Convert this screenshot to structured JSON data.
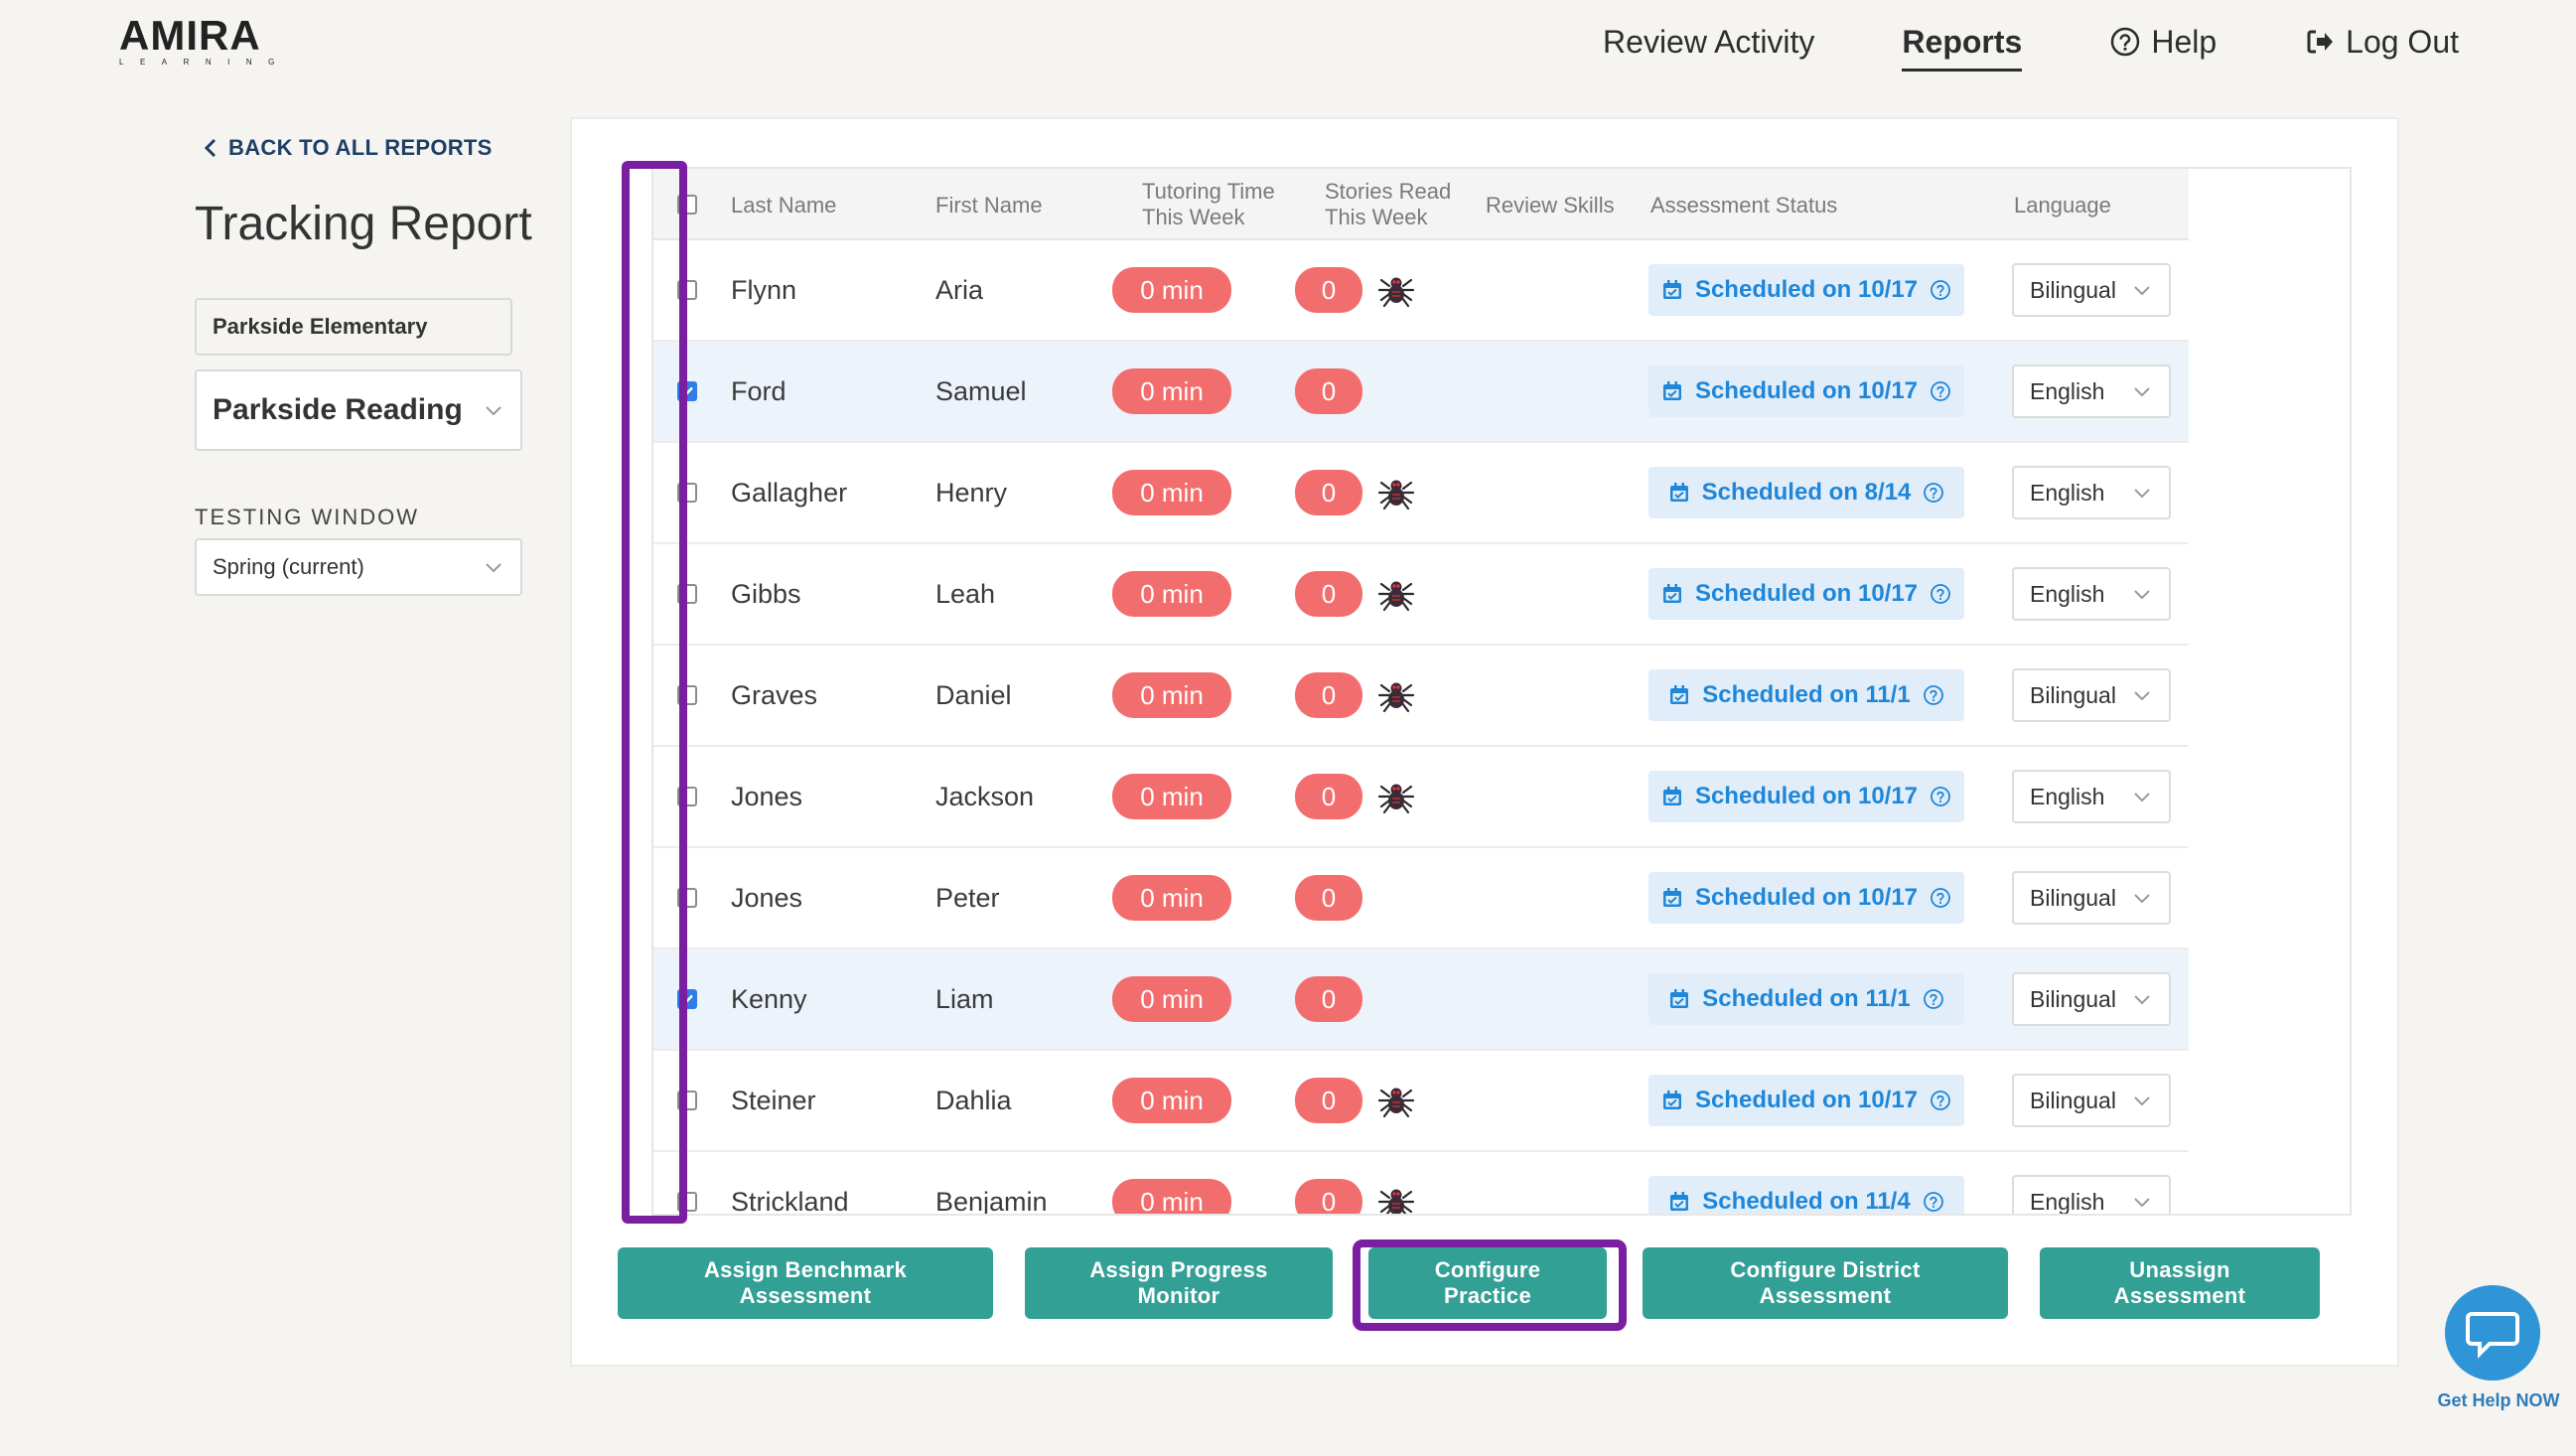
{
  "brand": {
    "name": "AMIRA",
    "sub": "LEARNING"
  },
  "nav": {
    "review_activity": "Review Activity",
    "reports": "Reports",
    "help": "Help",
    "logout": "Log Out"
  },
  "sidebar": {
    "back_label": "BACK TO ALL REPORTS",
    "title": "Tracking Report",
    "school": "Parkside Elementary",
    "class_name": "Parkside Reading",
    "testing_window_label": "TESTING WINDOW",
    "testing_window_value": "Spring (current)"
  },
  "table": {
    "headers": {
      "last_name": "Last Name",
      "first_name": "First Name",
      "tutoring_line1": "Tutoring Time",
      "tutoring_line2": "This Week",
      "stories_line1": "Stories Read",
      "stories_line2": "This Week",
      "review_skills": "Review Skills",
      "assessment_status": "Assessment Status",
      "language": "Language"
    },
    "rows": [
      {
        "last": "Flynn",
        "first": "Aria",
        "time": "0 min",
        "stories": "0",
        "spider": true,
        "status": "Scheduled on 10/17",
        "language": "Bilingual",
        "checked": false
      },
      {
        "last": "Ford",
        "first": "Samuel",
        "time": "0 min",
        "stories": "0",
        "spider": false,
        "status": "Scheduled on 10/17",
        "language": "English",
        "checked": true
      },
      {
        "last": "Gallagher",
        "first": "Henry",
        "time": "0 min",
        "stories": "0",
        "spider": true,
        "status": "Scheduled on 8/14",
        "language": "English",
        "checked": false
      },
      {
        "last": "Gibbs",
        "first": "Leah",
        "time": "0 min",
        "stories": "0",
        "spider": true,
        "status": "Scheduled on 10/17",
        "language": "English",
        "checked": false
      },
      {
        "last": "Graves",
        "first": "Daniel",
        "time": "0 min",
        "stories": "0",
        "spider": true,
        "status": "Scheduled on 11/1",
        "language": "Bilingual",
        "checked": false
      },
      {
        "last": "Jones",
        "first": "Jackson",
        "time": "0 min",
        "stories": "0",
        "spider": true,
        "status": "Scheduled on 10/17",
        "language": "English",
        "checked": false
      },
      {
        "last": "Jones",
        "first": "Peter",
        "time": "0 min",
        "stories": "0",
        "spider": false,
        "status": "Scheduled on 10/17",
        "language": "Bilingual",
        "checked": false
      },
      {
        "last": "Kenny",
        "first": "Liam",
        "time": "0 min",
        "stories": "0",
        "spider": false,
        "status": "Scheduled on 11/1",
        "language": "Bilingual",
        "checked": true
      },
      {
        "last": "Steiner",
        "first": "Dahlia",
        "time": "0 min",
        "stories": "0",
        "spider": true,
        "status": "Scheduled on 10/17",
        "language": "Bilingual",
        "checked": false
      },
      {
        "last": "Strickland",
        "first": "Benjamin",
        "time": "0 min",
        "stories": "0",
        "spider": true,
        "status": "Scheduled on 11/4",
        "language": "English",
        "checked": false
      }
    ]
  },
  "actions": [
    {
      "label_line1": "Assign Benchmark",
      "label_line2": "Assessment"
    },
    {
      "label_line1": "Assign Progress",
      "label_line2": "Monitor"
    },
    {
      "label_line1": "Configure",
      "label_line2": "Practice"
    },
    {
      "label_line1": "Configure District",
      "label_line2": "Assessment"
    },
    {
      "label_line1": "Unassign",
      "label_line2": "Assessment"
    }
  ],
  "help_widget": {
    "label": "Get Help NOW"
  },
  "colors": {
    "accent_teal": "#33a096",
    "pill_red": "#f26d6d",
    "status_blue": "#1f86d8",
    "highlight_purple": "#7b1fa2",
    "nav_dark": "#1f3f67"
  }
}
